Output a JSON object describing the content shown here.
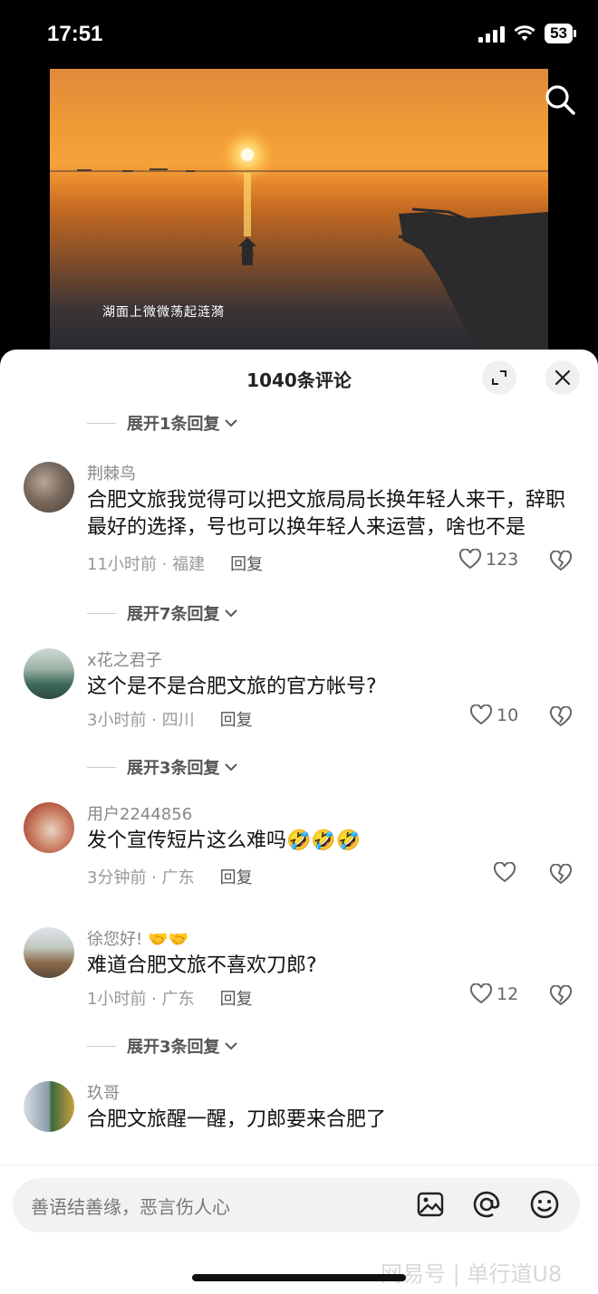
{
  "status": {
    "time": "17:51",
    "battery": "53"
  },
  "video": {
    "caption": "湖面上微微荡起涟漪"
  },
  "sheet": {
    "title": "1040条评论"
  },
  "comments": [
    {
      "expand_before": "展开1条回复",
      "user": "荆棘鸟",
      "text": "合肥文旅我觉得可以把文旅局局长换年轻人来干，辞职最好的选择，号也可以换年轻人来运营，啥也不是",
      "time_loc": "11小时前 · 福建",
      "reply": "回复",
      "likes": "123"
    },
    {
      "expand_before": "展开7条回复",
      "user": "x花之君子",
      "text": "这个是不是合肥文旅的官方帐号?",
      "time_loc": "3小时前 · 四川",
      "reply": "回复",
      "likes": "10"
    },
    {
      "expand_before": "展开3条回复",
      "user": "用户2244856",
      "text": "发个宣传短片这么难吗🤣🤣🤣",
      "time_loc": "3分钟前 · 广东",
      "reply": "回复",
      "likes": ""
    },
    {
      "expand_before": "",
      "user": "徐您好!",
      "user_emoji": "🤝🤝",
      "text": "难道合肥文旅不喜欢刀郎?",
      "time_loc": "1小时前 · 广东",
      "reply": "回复",
      "likes": "12"
    },
    {
      "expand_before": "展开3条回复",
      "user": "玖哥",
      "text": "合肥文旅醒一醒，刀郎要来合肥了",
      "time_loc": "",
      "reply": "",
      "likes": ""
    }
  ],
  "input": {
    "placeholder": "善语结善缘，恶言伤人心"
  },
  "watermark": "网易号 | 单行道U8"
}
